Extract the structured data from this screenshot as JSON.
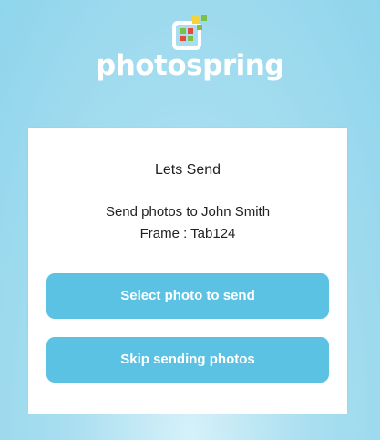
{
  "brand": {
    "name": "photospring",
    "logo_icon": "photospring-logo-icon",
    "colors": {
      "logo_green": "#7cc142",
      "logo_red": "#e8473c",
      "logo_yellow": "#f5d33a",
      "logo_frame": "#ffffff"
    }
  },
  "card": {
    "title": "Lets Send",
    "recipient_text": "Send photos to John Smith",
    "frame_text": "Frame : Tab124"
  },
  "actions": {
    "select_label": "Select photo to send",
    "skip_label": "Skip sending photos"
  },
  "colors": {
    "button": "#5bc2e3",
    "background": "#a9def0",
    "card": "#ffffff"
  }
}
